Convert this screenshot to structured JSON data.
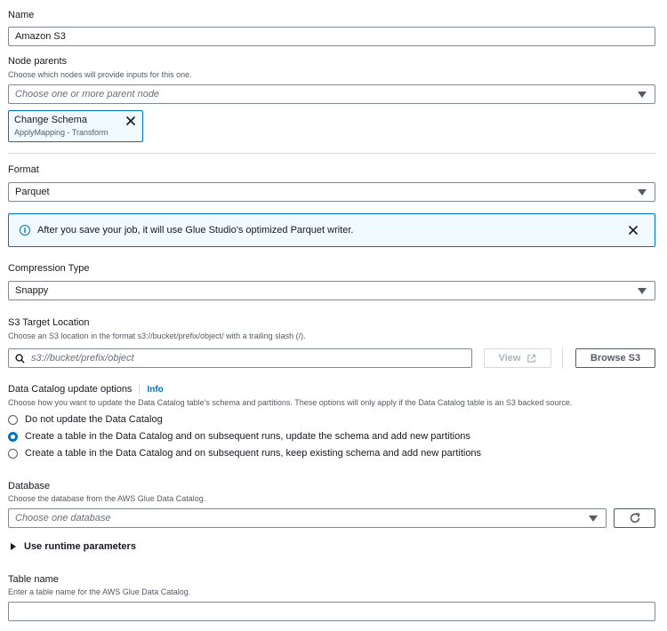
{
  "name": {
    "label": "Name",
    "value": "Amazon S3"
  },
  "node_parents": {
    "label": "Node parents",
    "description": "Choose which nodes will provide inputs for this one.",
    "placeholder": "Choose one or more parent node",
    "token": {
      "title": "Change Schema",
      "subtitle": "ApplyMapping - Transform"
    }
  },
  "format": {
    "label": "Format",
    "value": "Parquet"
  },
  "flash": {
    "message": "After you save your job, it will use Glue Studio's optimized Parquet writer."
  },
  "compression": {
    "label": "Compression Type",
    "value": "Snappy"
  },
  "s3_target": {
    "label": "S3 Target Location",
    "description": "Choose an S3 location in the format s3://bucket/prefix/object/ with a trailing slash (/).",
    "placeholder": "s3://bucket/prefix/object",
    "view_label": "View",
    "browse_label": "Browse S3"
  },
  "catalog_update": {
    "label": "Data Catalog update options",
    "info_label": "Info",
    "description": "Choose how you want to update the Data Catalog table's schema and partitions. These options will only apply if the Data Catalog table is an S3 backed source.",
    "options": [
      {
        "label": "Do not update the Data Catalog",
        "checked": false
      },
      {
        "label": "Create a table in the Data Catalog and on subsequent runs, update the schema and add new partitions",
        "checked": true
      },
      {
        "label": "Create a table in the Data Catalog and on subsequent runs, keep existing schema and add new partitions",
        "checked": false
      }
    ]
  },
  "database": {
    "label": "Database",
    "description": "Choose the database from the AWS Glue Data Catalog.",
    "placeholder": "Choose one database"
  },
  "runtime_params": {
    "label": "Use runtime parameters"
  },
  "table_name": {
    "label": "Table name",
    "description": "Enter a table name for the AWS Glue Data Catalog.",
    "value": ""
  },
  "colors": {
    "accent": "#0073bb",
    "border": "#7d8998",
    "text": "#16191f",
    "muted": "#545b64"
  }
}
